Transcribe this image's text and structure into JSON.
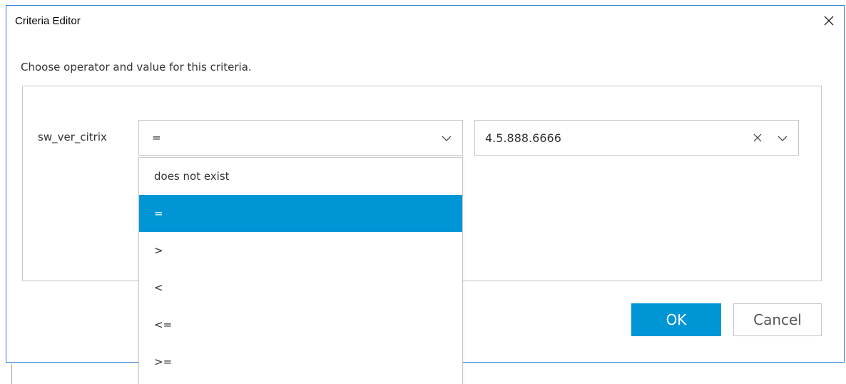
{
  "dialog": {
    "title": "Criteria Editor",
    "instruction": "Choose operator and value for this criteria."
  },
  "criteria": {
    "field_label": "sw_ver_citrix",
    "operator_selected": "=",
    "value": "4.5.888.6666"
  },
  "operator_options": [
    {
      "label": "does not exist"
    },
    {
      "label": "="
    },
    {
      "label": ">"
    },
    {
      "label": "<"
    },
    {
      "label": "<="
    },
    {
      "label": ">="
    }
  ],
  "buttons": {
    "ok_label": "OK",
    "cancel_label": "Cancel"
  },
  "icons": {
    "close": "close-icon",
    "dropdown": "chevron-down-icon",
    "clear": "clear-icon"
  },
  "colors": {
    "accent": "#0096d6",
    "window_border": "#2b7cd3",
    "border": "#c8c8c8"
  }
}
